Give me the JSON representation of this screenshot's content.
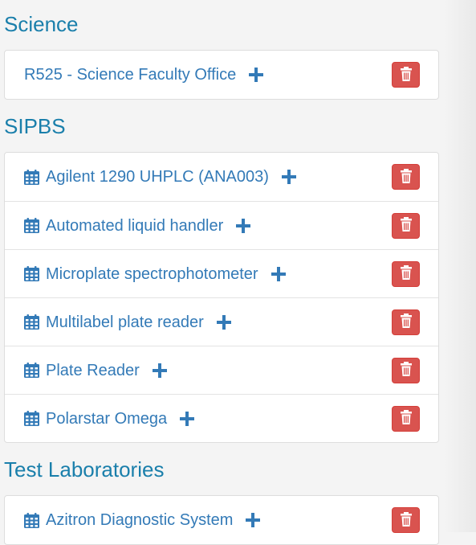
{
  "sections": [
    {
      "title": "Science",
      "items": [
        {
          "label": "R525 - Science Faculty Office",
          "calendar_icon": false
        }
      ]
    },
    {
      "title": "SIPBS",
      "items": [
        {
          "label": "Agilent 1290 UHPLC (ANA003)",
          "calendar_icon": true
        },
        {
          "label": "Automated liquid handler",
          "calendar_icon": true
        },
        {
          "label": "Microplate spectrophotometer",
          "calendar_icon": true
        },
        {
          "label": "Multilabel plate reader",
          "calendar_icon": true
        },
        {
          "label": "Plate Reader",
          "calendar_icon": true
        },
        {
          "label": "Polarstar Omega",
          "calendar_icon": true
        }
      ]
    },
    {
      "title": "Test Laboratories",
      "items": [
        {
          "label": "Azitron Diagnostic System",
          "calendar_icon": true
        }
      ]
    }
  ],
  "icons": {
    "calendar": "calendar-icon",
    "add": "plus-icon",
    "delete": "trash-icon"
  },
  "colors": {
    "heading": "#1a7fab",
    "link": "#337ab7",
    "delete_button": "#d9534f"
  }
}
